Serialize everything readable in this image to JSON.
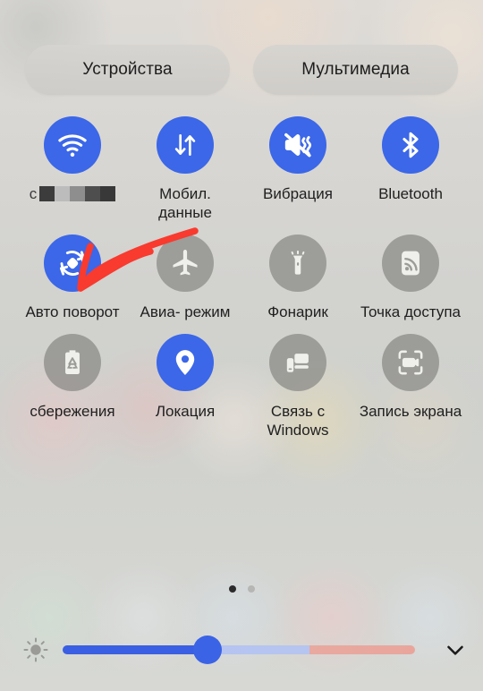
{
  "header": {
    "buttons": [
      {
        "label": "Устройства",
        "name": "devices"
      },
      {
        "label": "Мультимедиа",
        "name": "media"
      }
    ]
  },
  "toggles": {
    "rows": [
      [
        {
          "name": "wifi",
          "label": "",
          "icon": "wifi-icon",
          "state": "on",
          "redacted": true
        },
        {
          "name": "mobile-data",
          "label": "Мобил. данные",
          "icon": "mobile-data-icon",
          "state": "on",
          "redacted": false
        },
        {
          "name": "vibration",
          "label": "Вибрация",
          "icon": "vibration-icon",
          "state": "on",
          "redacted": false
        },
        {
          "name": "bluetooth",
          "label": "Bluetooth",
          "icon": "bluetooth-icon",
          "state": "on",
          "redacted": false
        }
      ],
      [
        {
          "name": "auto-rotate",
          "label": "Авто поворот",
          "icon": "auto-rotate-icon",
          "state": "on",
          "redacted": false
        },
        {
          "name": "airplane-mode",
          "label": "Авиа- режим",
          "icon": "airplane-icon",
          "state": "off",
          "redacted": false
        },
        {
          "name": "flashlight",
          "label": "Фонарик",
          "icon": "flashlight-icon",
          "state": "off",
          "redacted": false
        },
        {
          "name": "hotspot",
          "label": "Точка доступа",
          "icon": "hotspot-icon",
          "state": "off",
          "redacted": false
        }
      ],
      [
        {
          "name": "battery-saver",
          "label": "сбережения",
          "icon": "battery-saver-icon",
          "state": "off",
          "redacted": false
        },
        {
          "name": "location",
          "label": "Локация",
          "icon": "location-icon",
          "state": "on",
          "redacted": false
        },
        {
          "name": "link-to-windows",
          "label": "Связь с Windows",
          "icon": "link-to-windows-icon",
          "state": "off",
          "redacted": false
        },
        {
          "name": "screen-record",
          "label": "Запись экрана",
          "icon": "screen-record-icon",
          "state": "off",
          "redacted": false
        }
      ]
    ]
  },
  "pager": {
    "total": 2,
    "active_index": 0
  },
  "brightness": {
    "icon": "brightness-sun-icon",
    "value_percent": 41,
    "expand_icon": "chevron-down-icon"
  },
  "annotation": {
    "type": "hand-drawn-red-arrow",
    "points_to": "auto-rotate",
    "color": "#f93a2e"
  },
  "colors": {
    "active_toggle": "#3b67e8",
    "inactive_toggle": "#888885",
    "slider_fill": "#3b5fe2",
    "text": "#1f1f1f"
  }
}
